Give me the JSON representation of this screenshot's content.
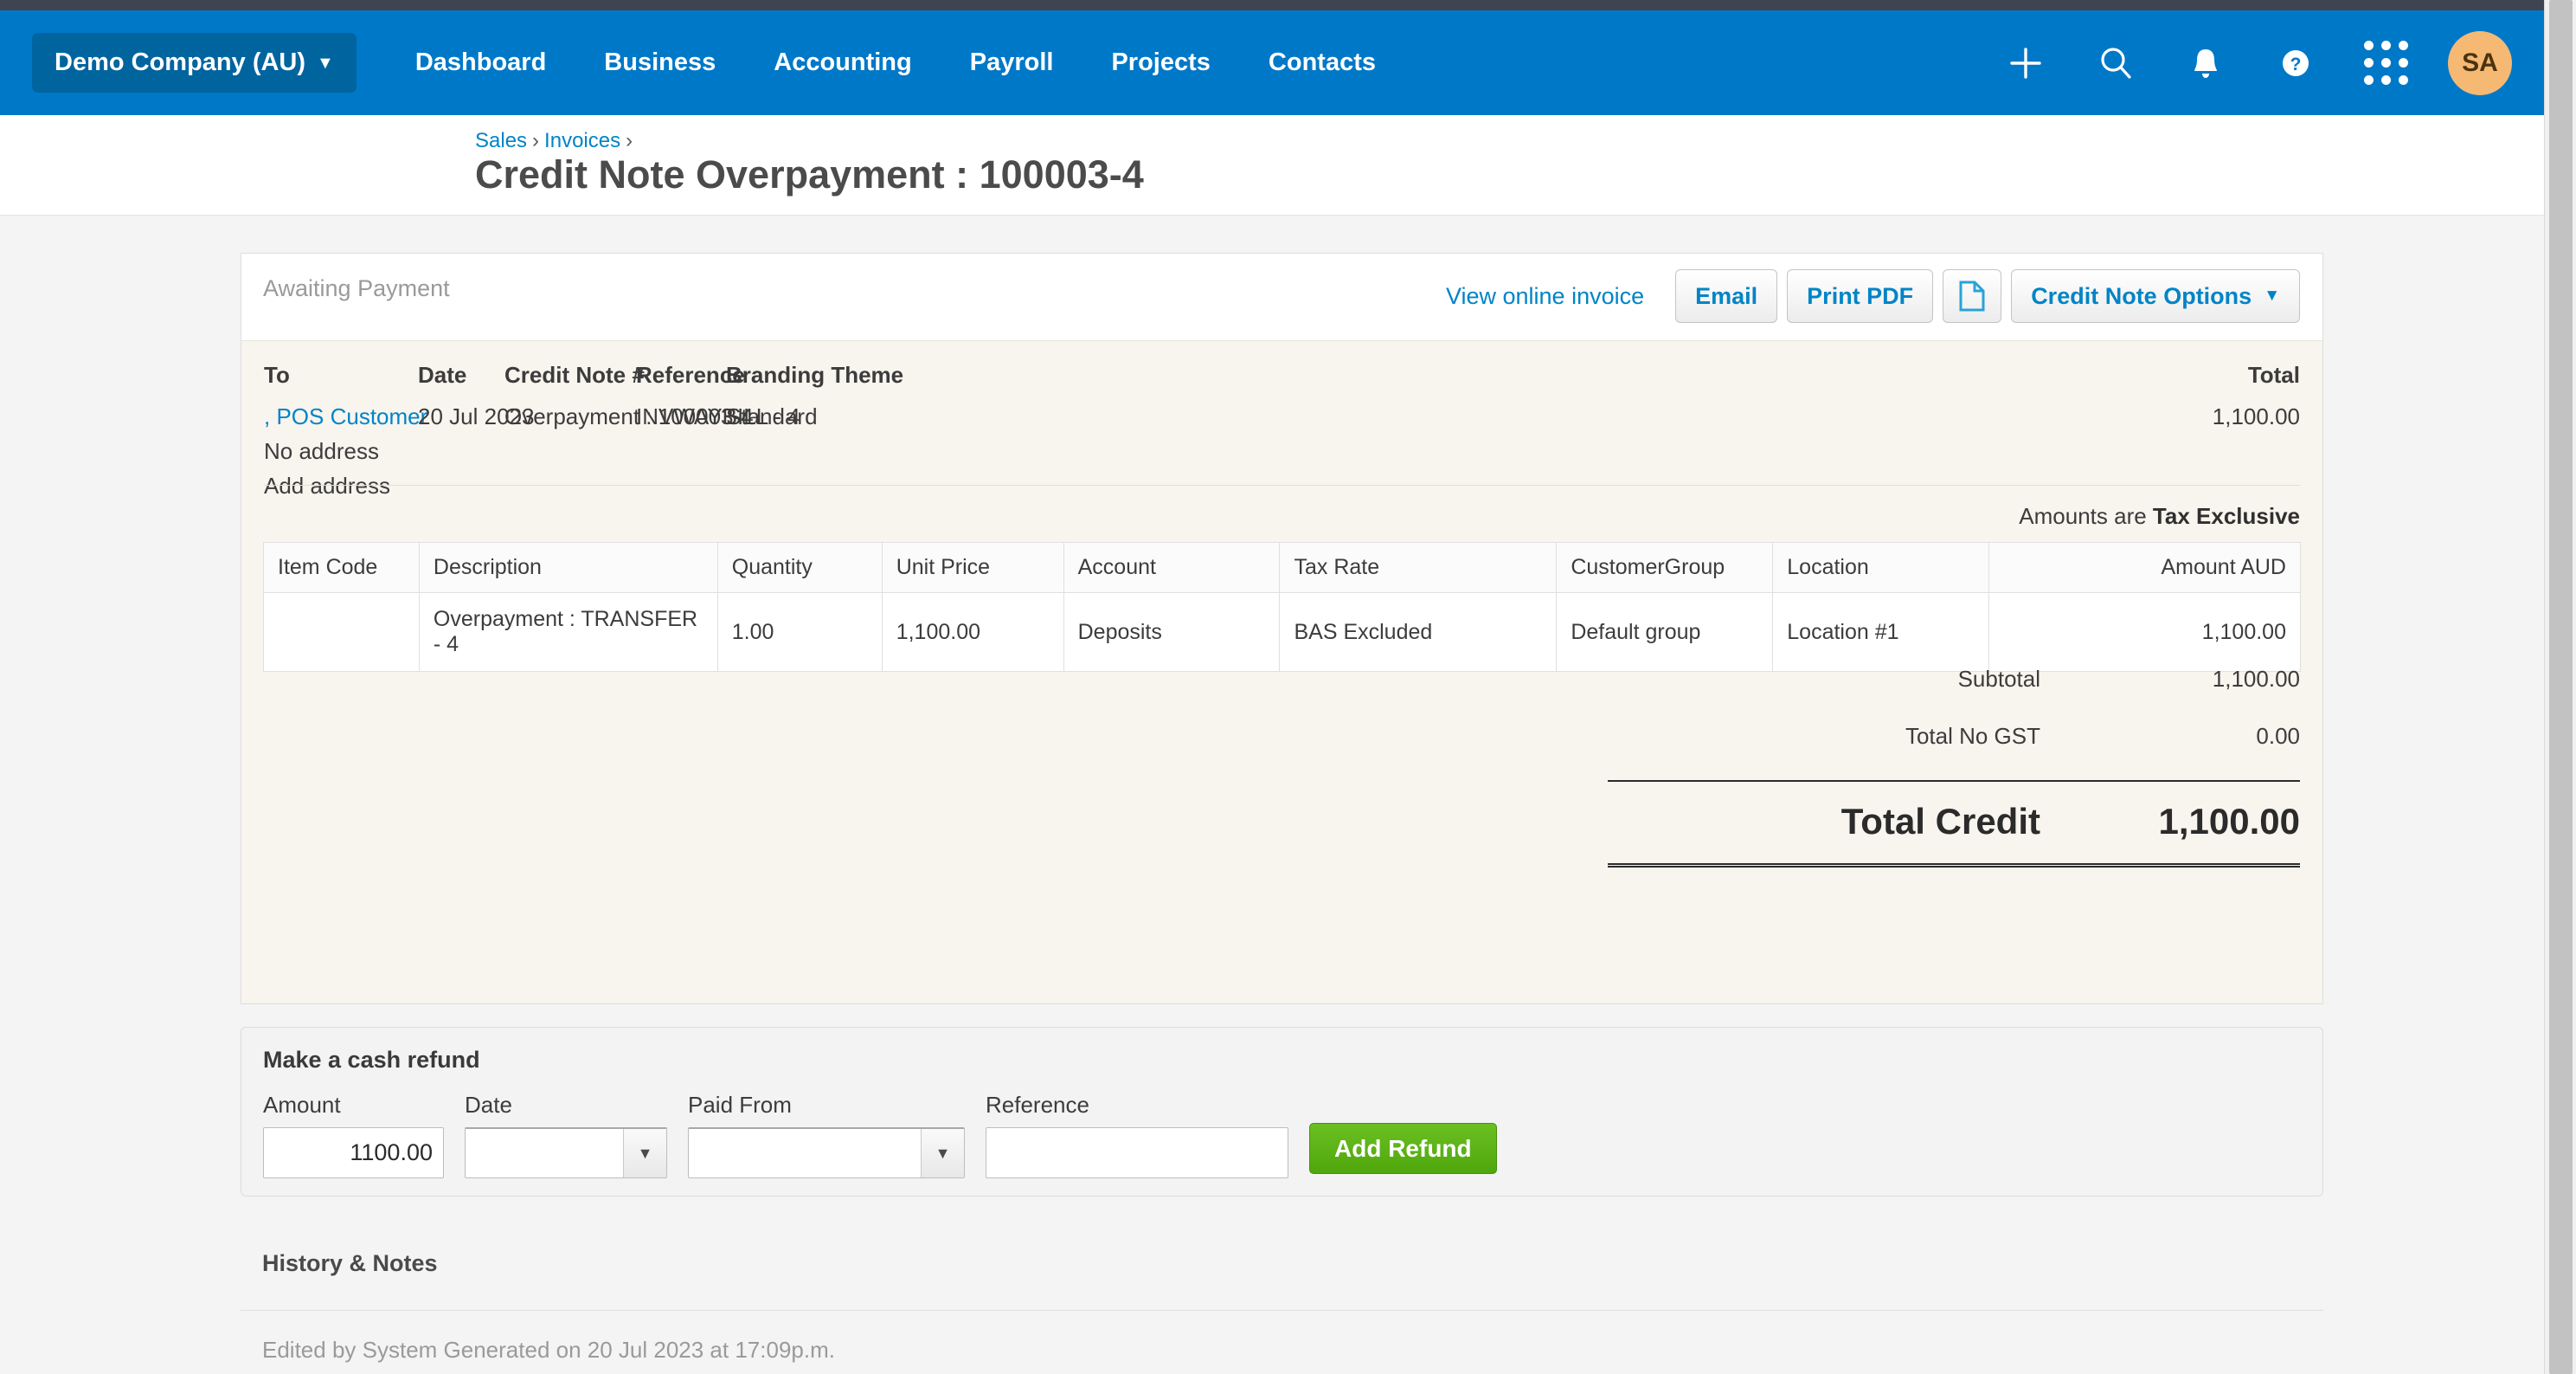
{
  "navbar": {
    "org_name": "Demo Company (AU)",
    "org_caret": "▼",
    "links": [
      {
        "label": "Dashboard"
      },
      {
        "label": "Business"
      },
      {
        "label": "Accounting"
      },
      {
        "label": "Payroll"
      },
      {
        "label": "Projects"
      },
      {
        "label": "Contacts"
      }
    ],
    "icons": [
      "plus-icon",
      "search-icon",
      "bell-icon",
      "help-icon",
      "apps-grid-icon"
    ],
    "avatar_initials": "SA",
    "colors": {
      "bar": "#0078c8",
      "org_button": "#00649f",
      "avatar": "#f5b974"
    }
  },
  "breadcrumb": {
    "items": [
      "Sales",
      "Invoices"
    ],
    "separator": "›"
  },
  "page": {
    "title": "Credit Note Overpayment : 100003-4"
  },
  "card": {
    "status": "Awaiting Payment",
    "view_online_link": "View online invoice",
    "buttons": {
      "email": "Email",
      "print_pdf": "Print PDF",
      "copy_icon": "document-icon",
      "options": "Credit Note Options",
      "options_caret": "▼"
    },
    "meta": {
      "to_label": "To",
      "to_value": ", POS Customer",
      "to_address": "No address",
      "to_add_address": "Add address",
      "date_label": "Date",
      "date_value": "20 Jul 2023",
      "credit_note_label": "Credit Note #",
      "credit_note_value": "Overpayment : 100003-4",
      "reference_label": "Reference",
      "reference_value": "INVWAYBILL - 4",
      "branding_label": "Branding Theme",
      "branding_value": "Standard",
      "total_label": "Total",
      "total_value": "1,100.00"
    },
    "tax_note_prefix": "Amounts are",
    "tax_note_value": "Tax Exclusive",
    "table": {
      "headers": [
        "Item Code",
        "Description",
        "Quantity",
        "Unit Price",
        "Account",
        "Tax Rate",
        "CustomerGroup",
        "Location",
        "Amount AUD"
      ],
      "rows": [
        {
          "item_code": "",
          "description": "Overpayment : TRANSFER - 4",
          "quantity": "1.00",
          "unit_price": "1,100.00",
          "account": "Deposits",
          "tax_rate": "BAS Excluded",
          "customer_group": "Default group",
          "location": "Location #1",
          "amount": "1,100.00"
        }
      ]
    },
    "totals": {
      "subtotal_label": "Subtotal",
      "subtotal_value": "1,100.00",
      "no_gst_label": "Total No GST",
      "no_gst_value": "0.00",
      "grand_label": "Total Credit",
      "grand_value": "1,100.00"
    }
  },
  "refund": {
    "title": "Make a cash refund",
    "amount_label": "Amount",
    "amount_value": "1100.00",
    "date_label": "Date",
    "date_value": "",
    "paid_from_label": "Paid From",
    "paid_from_value": "",
    "reference_label": "Reference",
    "reference_value": "",
    "add_button": "Add Refund",
    "caret": "▼"
  },
  "history": {
    "title": "History & Notes",
    "entry": "Edited by System Generated on 20 Jul 2023 at 17:09p.m."
  }
}
